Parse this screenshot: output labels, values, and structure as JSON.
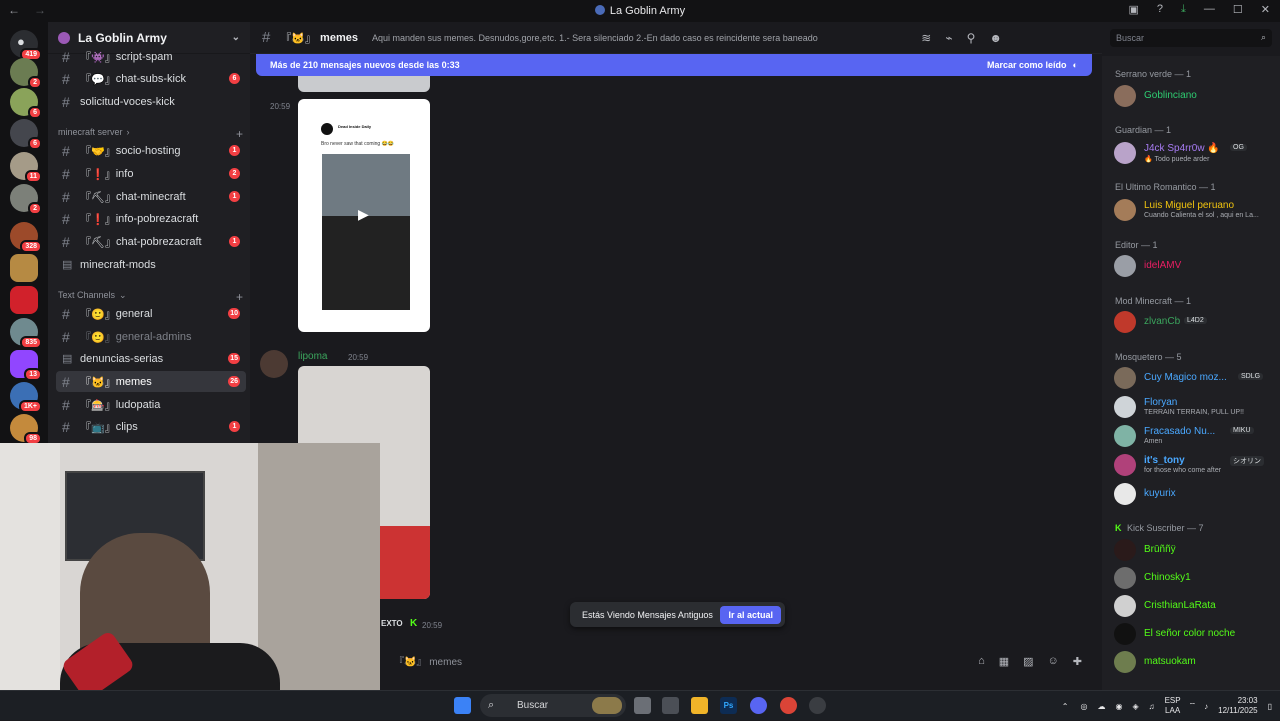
{
  "window": {
    "title": "La Goblin Army",
    "back_icon": "arrow-left-icon",
    "forward_icon": "arrow-right-icon"
  },
  "guild_badges": [
    "419",
    "2",
    "6",
    "6",
    "11",
    "2",
    "328",
    "835",
    "13",
    "1K+",
    "98"
  ],
  "server": {
    "name": "La Goblin Army"
  },
  "channels": {
    "top": [
      {
        "emoji": "『👾』",
        "name": "script-spam"
      },
      {
        "emoji": "『💬』",
        "name": "chat-subs-kick",
        "count": "6"
      },
      {
        "emoji": "",
        "name": "solicitud-voces-kick"
      }
    ],
    "minecraft_category": "minecraft server",
    "minecraft": [
      {
        "emoji": "『🤝』",
        "name": "socio-hosting",
        "count": "1"
      },
      {
        "emoji": "『❗』",
        "name": "info",
        "count": "2"
      },
      {
        "emoji": "『⛏』",
        "name": "chat-minecraft",
        "count": "1"
      },
      {
        "emoji": "『❗』",
        "name": "info-pobrezacraft"
      },
      {
        "emoji": "『⛏』",
        "name": "chat-pobrezacraft",
        "count": "1"
      },
      {
        "emoji": "",
        "name": "minecraft-mods"
      }
    ],
    "text_category": "Text Channels",
    "text": [
      {
        "emoji": "『🙂』",
        "name": "general",
        "count": "10"
      },
      {
        "emoji": "『🙂』",
        "name": "general-admins"
      },
      {
        "emoji": "",
        "name": "denuncias-serias",
        "count": "15"
      },
      {
        "emoji": "『🐱』",
        "name": "memes",
        "count": "26"
      },
      {
        "emoji": "『🎰』",
        "name": "ludopatia"
      },
      {
        "emoji": "『📺』",
        "name": "clips",
        "count": "1"
      }
    ]
  },
  "header": {
    "channel_emoji": "『🐱』",
    "channel_name": "memes",
    "topic": "Aqui manden sus memes. Desnudos,gore,etc. 1.- Sera silenciado 2.-En dado caso es reincidente sera baneado"
  },
  "search": {
    "placeholder": "Buscar"
  },
  "new_messages": {
    "text": "Más de 210 mensajes nuevos desde las 0:33",
    "action": "Marcar como leído"
  },
  "messages": [
    {
      "time": "20:59",
      "card_title": "Dead Inside Daily",
      "card_text": "Bro never saw that coming 😂😂"
    },
    {
      "author": "lipoma",
      "time": "20:59"
    },
    {
      "author_partial": "EXTO",
      "time": "20:59"
    }
  ],
  "old_messages": {
    "text": "Estás Viendo Mensajes Antiguos",
    "button": "Ir al actual"
  },
  "input": {
    "placeholder": "『🐱』 memes"
  },
  "members": [
    {
      "role": "Serrano verde — 1",
      "people": [
        {
          "name": "Goblinciano",
          "color": "#2ecc71"
        }
      ]
    },
    {
      "role": "Guardian — 1",
      "people": [
        {
          "name": "J4ck Sp4rr0w 🔥",
          "color": "#a77bf3",
          "tag": "OG",
          "status": "🔥 Todo puede arder"
        }
      ]
    },
    {
      "role": "El Ultimo Romantico — 1",
      "people": [
        {
          "name": "Luis Miguel peruano",
          "color": "#f1c40f",
          "status": "Cuando Calienta el sol , aqui en La..."
        }
      ]
    },
    {
      "role": "Editor — 1",
      "people": [
        {
          "name": "idelAMV",
          "color": "#e91e63"
        }
      ]
    },
    {
      "role": "Mod Minecraft — 1",
      "people": [
        {
          "name": "zlvanCb",
          "color": "#3ba55d",
          "tag": "L4D2"
        }
      ]
    },
    {
      "role": "Mosquetero — 5",
      "people": [
        {
          "name": "Cuy Magico moz...",
          "color": "#4aa8ff",
          "tag": "SDLG"
        },
        {
          "name": "Floryan",
          "color": "#4aa8ff",
          "status": "TERRAIN TERRAIN, PULL UP!!"
        },
        {
          "name": "Fracasado Nu...",
          "color": "#4aa8ff",
          "tag": "MIKU",
          "status": "Amen"
        },
        {
          "name": "it's_tony",
          "color": "#4aa8ff",
          "tag": "シオリン",
          "status": "for those who come after"
        },
        {
          "name": "kuyurix",
          "color": "#4aa8ff"
        }
      ]
    },
    {
      "role": "Kick Suscriber — 7",
      "people": [
        {
          "name": "Brūññÿ",
          "color": "#53fc18"
        },
        {
          "name": "Chinosky1",
          "color": "#53fc18"
        },
        {
          "name": "CristhianLaRata",
          "color": "#53fc18"
        },
        {
          "name": "El señor color noche",
          "color": "#53fc18"
        },
        {
          "name": "matsuokam",
          "color": "#53fc18"
        }
      ]
    }
  ],
  "taskbar": {
    "search": "Buscar",
    "lang": "ESP",
    "lang2": "LAA",
    "time": "23:03",
    "date": "12/11/2025"
  },
  "colors": {
    "accent": "#5865f2",
    "unread": "#f23f43",
    "kick": "#53fc18"
  }
}
